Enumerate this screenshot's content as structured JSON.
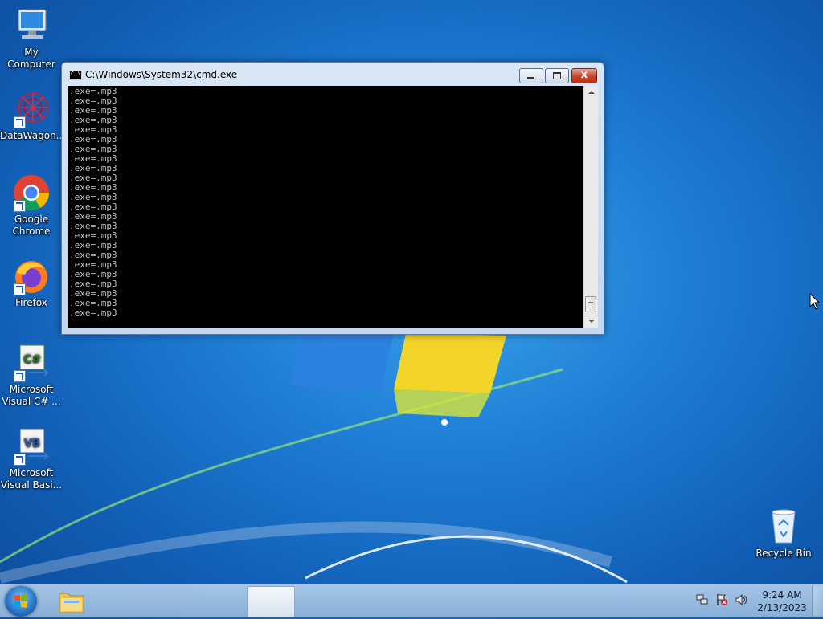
{
  "desktop": {
    "icons": [
      {
        "label": "My Computer"
      },
      {
        "label": "DataWagon..."
      },
      {
        "label": "Google Chrome"
      },
      {
        "label": "Firefox"
      },
      {
        "label": "Microsoft Visual C# ..."
      },
      {
        "label": "Microsoft Visual Basi..."
      },
      {
        "label": "Recycle Bin"
      }
    ]
  },
  "cmd_window": {
    "title": "C:\\Windows\\System32\\cmd.exe",
    "icon_text": "C:\\",
    "lines": [
      ".exe=.mp3",
      ".exe=.mp3",
      ".exe=.mp3",
      ".exe=.mp3",
      ".exe=.mp3",
      ".exe=.mp3",
      ".exe=.mp3",
      ".exe=.mp3",
      ".exe=.mp3",
      ".exe=.mp3",
      ".exe=.mp3",
      ".exe=.mp3",
      ".exe=.mp3",
      ".exe=.mp3",
      ".exe=.mp3",
      ".exe=.mp3",
      ".exe=.mp3",
      ".exe=.mp3",
      ".exe=.mp3",
      ".exe=.mp3",
      ".exe=.mp3",
      ".exe=.mp3",
      ".exe=.mp3",
      ".exe=.mp3"
    ],
    "close_label": "x"
  },
  "taskbar": {
    "clock_time": "9:24 AM",
    "clock_date": "2/13/2023"
  },
  "colors": {
    "wallpaper": "#1f7fd6",
    "console_bg": "#000000",
    "console_fg": "#c0c0c0",
    "close_button": "#c7442b"
  }
}
